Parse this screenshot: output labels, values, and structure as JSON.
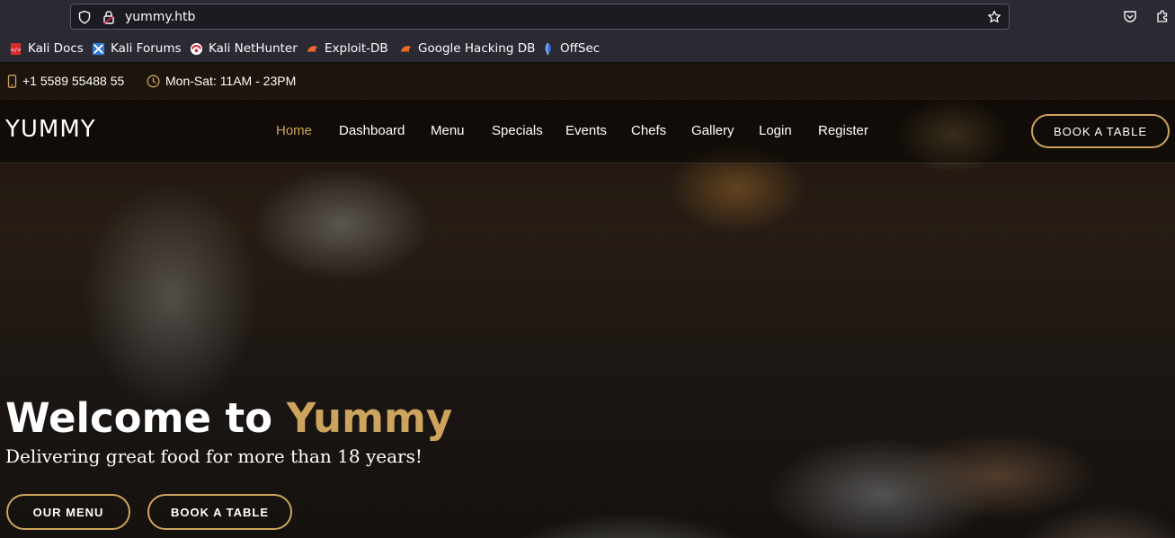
{
  "colors": {
    "accent": "#cda45e",
    "browser_toolbar": "#2b2a33",
    "urlbar": "#1c1b22"
  },
  "browser": {
    "url": "yummy.htb",
    "icons": [
      "shield-icon",
      "lock-warning-icon",
      "star-icon",
      "pocket-icon",
      "extensions-icon"
    ],
    "bookmarks": [
      {
        "label": "Kali Docs",
        "icon": "kali-docs-favicon"
      },
      {
        "label": "Kali Forums",
        "icon": "kali-forums-favicon"
      },
      {
        "label": "Kali NetHunter",
        "icon": "kali-nethunter-favicon"
      },
      {
        "label": "Exploit-DB",
        "icon": "exploit-db-favicon"
      },
      {
        "label": "Google Hacking DB",
        "icon": "google-hacking-db-favicon"
      },
      {
        "label": "OffSec",
        "icon": "offsec-favicon"
      }
    ]
  },
  "topbar": {
    "phone": "+1 5589 55488 55",
    "hours": "Mon-Sat: 11AM - 23PM"
  },
  "header": {
    "logo": "YUMMY",
    "nav": [
      "Home",
      "Dashboard",
      "Menu",
      "Specials",
      "Events",
      "Chefs",
      "Gallery",
      "Login",
      "Register"
    ],
    "active_nav": "Home",
    "cta": "BOOK A TABLE"
  },
  "hero": {
    "title_prefix": "Welcome to ",
    "title_accent": "Yummy",
    "subtitle": "Delivering great food for more than 18 years!",
    "buttons": [
      "OUR MENU",
      "BOOK A TABLE"
    ]
  }
}
